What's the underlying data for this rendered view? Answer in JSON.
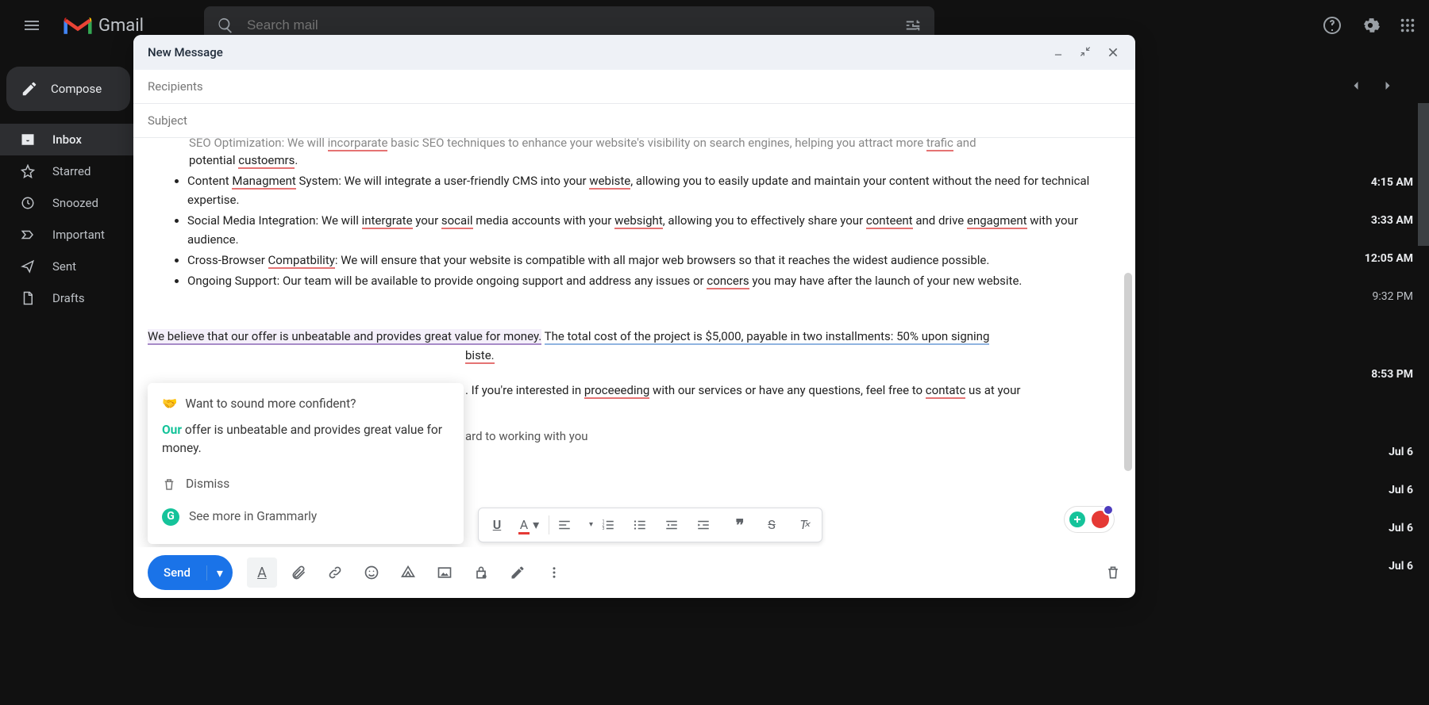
{
  "app": {
    "name": "Gmail"
  },
  "search": {
    "placeholder": "Search mail"
  },
  "sidebar": {
    "compose": "Compose",
    "items": [
      {
        "label": "Inbox",
        "active": true
      },
      {
        "label": "Starred",
        "active": false
      },
      {
        "label": "Snoozed",
        "active": false
      },
      {
        "label": "Important",
        "active": false
      },
      {
        "label": "Sent",
        "active": false
      },
      {
        "label": "Drafts",
        "active": false
      }
    ]
  },
  "timestamps": [
    "4:15 AM",
    "3:33 AM",
    "12:05 AM",
    "9:32 PM",
    "8:53 PM",
    "Jul 6",
    "Jul 6",
    "Jul 6",
    "Jul 6"
  ],
  "compose": {
    "title": "New Message",
    "recipients_placeholder": "Recipients",
    "subject_placeholder": "Subject",
    "send": "Send",
    "body": {
      "partial_seo": "SEO Optimization: We will incorparate basic SEO techniques to enhance your website's visibility on search engines, helping you attract more trafic and potential custoemrs.",
      "bullet_cms": "Content Managment System: We will integrate a user-friendly CMS into your webiste, allowing you to easily update and maintain your content without the need for technical expertise.",
      "bullet_social": "Social Media Integration: We will intergrate your socail media accounts with your websight, allowing you to effectively share your conteent and drive engagment with your audience.",
      "bullet_browser": "Cross-Browser Compatbility: We will ensure that your website is compatible with all major web browsers so that it reaches the widest audience possible.",
      "bullet_support": "Ongoing Support: Our team will be available to provide ongoing support and address any issues or concers you may have after the launch of your new website.",
      "price_sentence_a": "We believe that our offer is unbeatable and provides great value for money.",
      "price_sentence_b": "The total cost of the project is $5,000, payable in two installments: 50% upon signing",
      "fragment_biste": "biste.",
      "proceed_sentence": ". If you're interested in proceeeding with our services or have any questions, feel free to contatc us at your",
      "closing_fragment": "ard to working with you"
    }
  },
  "grammarly": {
    "heading": "Want to sound more confident?",
    "our": "Our",
    "suggestion_tail": " offer is unbeatable and provides great value for money.",
    "dismiss": "Dismiss",
    "see_more": "See more in Grammarly"
  }
}
